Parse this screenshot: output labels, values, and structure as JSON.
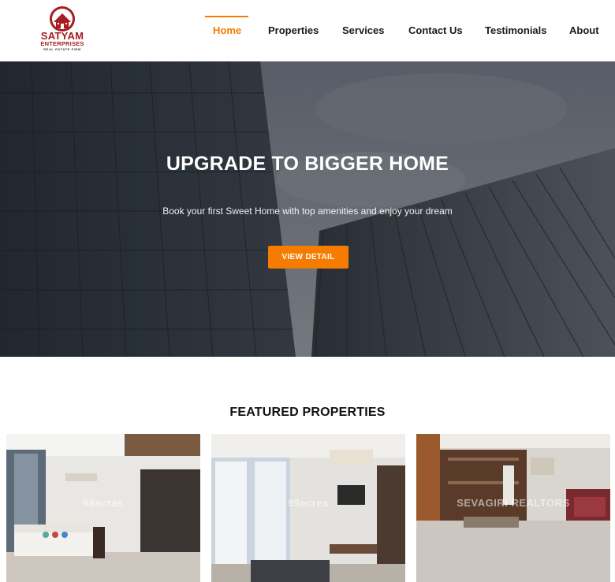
{
  "brand": {
    "name": "SATYAM",
    "tagline": "ENTERPRISES",
    "subtag": "REAL ESTATE FIRM",
    "color": "#a71d22"
  },
  "nav": {
    "items": [
      {
        "label": "Home",
        "active": true
      },
      {
        "label": "Properties",
        "active": false
      },
      {
        "label": "Services",
        "active": false
      },
      {
        "label": "Contact Us",
        "active": false
      },
      {
        "label": "Testimonials",
        "active": false
      },
      {
        "label": "About",
        "active": false
      }
    ],
    "accent_color": "#f57c00"
  },
  "hero": {
    "title": "UPGRADE TO BIGGER HOME",
    "subtitle": "Book your first Sweet Home with top amenities and enjoy your dream",
    "button_label": "VIEW DETAIL",
    "button_color": "#f57c00"
  },
  "featured": {
    "title": "FEATURED PROPERTIES",
    "cards": [
      {
        "watermark": "99acres"
      },
      {
        "watermark": "99acres"
      },
      {
        "watermark": "SEVAGIRI REALTORS"
      }
    ]
  }
}
